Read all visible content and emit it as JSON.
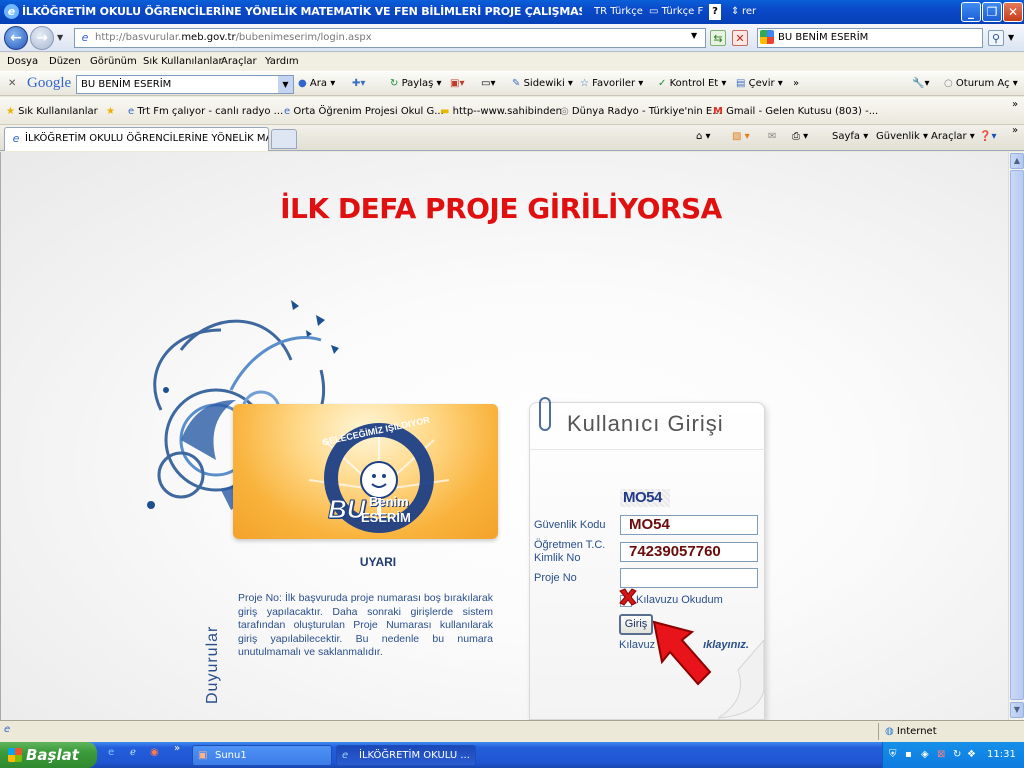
{
  "window": {
    "title": "İLKÖĞRETİM OKULU ÖĞRENCİLERİNE YÖNELİK MATEMATİK VE FEN BİLİMLERİ PROJE ÇALIŞMASI PROJE Gİ",
    "lang_code": "TR",
    "lang_label": "Türkçe",
    "lang2_label": "Türkçe F",
    "lang_tail": "rer"
  },
  "address_bar": {
    "url_prefix": "http://basvurular.",
    "url_domain": "meb.gov.tr",
    "url_path": "/bubenimeserim/login.aspx",
    "search_value": "BU BENİM ESERİM"
  },
  "menu": [
    "Dosya",
    "Düzen",
    "Görünüm",
    "Sık Kullanılanlar",
    "Araçlar",
    "Yardım"
  ],
  "google_toolbar": {
    "logo": "Google",
    "search_value": "BU BENİM ESERİM",
    "items": [
      "Ara",
      "Paylaş",
      "Sidewiki",
      "Favoriler",
      "Kontrol Et",
      "Çevir"
    ],
    "signin": "Oturum Aç"
  },
  "favorites_bar": {
    "label": "Sık Kullanılanlar",
    "items": [
      "Trt Fm çalıyor - canlı radyo ...",
      "Orta Öğrenim Projesi Okul G...",
      "http--www.sahibinden",
      "Dünya Radyo - Türkiye'nin E...",
      "Gmail - Gelen Kutusu (803) -..."
    ]
  },
  "tab": {
    "title": "İLKÖĞRETİM OKULU ÖĞRENCİLERİNE YÖNELİK MATE...",
    "tools": [
      "Sayfa",
      "Güvenlik",
      "Araçlar"
    ]
  },
  "page": {
    "heading": "İLK DEFA PROJE GİRİLİYORSA",
    "logo_arc_text": "GELECEĞİMİZ IŞILDIYOR",
    "logo_main": "BU",
    "logo_benim": "Benim",
    "logo_eserim": "ESERİM",
    "warning_title": "UYARI",
    "side_label": "Duyurular",
    "warning_text": "Proje No: İlk başvuruda proje numarası boş bırakılarak giriş yapılacaktır. Daha sonraki girişlerde sistem tarafından oluşturulan Proje Numarası kullanılarak giriş yapılabilecektir. Bu nedenle bu numara unutulmamalı ve saklanmalıdır."
  },
  "login": {
    "title": "Kullanıcı Girişi",
    "captcha": "MO54",
    "security_code_label": "Güvenlik Kodu",
    "security_code_value": "MO54",
    "teacher_id_label_line1": "Öğretmen T.C.",
    "teacher_id_label_line2": "Kimlik No",
    "teacher_id_value": "74239057760",
    "project_no_label": "Proje No",
    "project_no_value": "",
    "checkbox_label": "Kılavuzu Okudum",
    "submit_label": "Giriş",
    "guide_prefix": "Kılavuz",
    "guide_link": "ıklayınız."
  },
  "status_bar": {
    "zone": "Internet"
  },
  "taskbar": {
    "start": "Başlat",
    "buttons": [
      "Sunu1",
      "İLKÖĞRETİM OKULU ..."
    ],
    "clock": "11:31"
  },
  "colors": {
    "heading": "#e01010",
    "accent_blue": "#2a4f8c",
    "input_text": "#6b0c0c",
    "arrow": "#e8141a"
  }
}
